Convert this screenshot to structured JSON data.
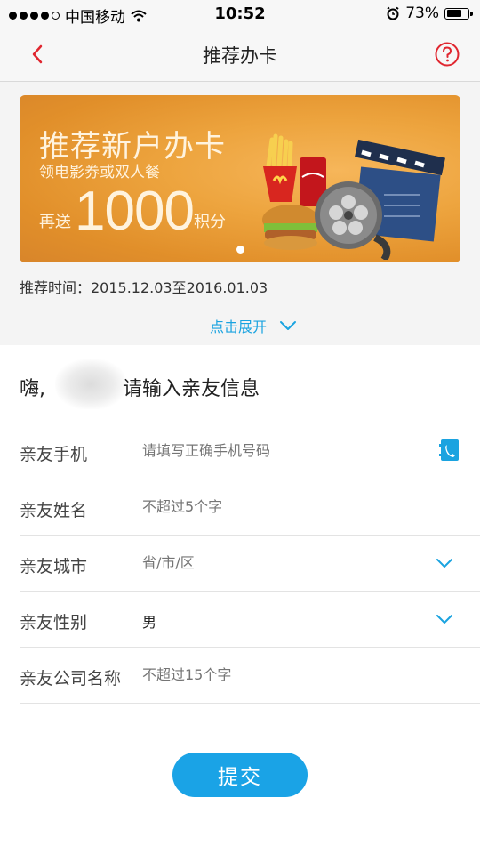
{
  "status_bar": {
    "carrier": "中国移动",
    "time": "10:52",
    "battery_percent": "73%",
    "battery_level": 0.73,
    "icons": [
      "signal-dots-icon",
      "wifi-icon",
      "alarm-icon",
      "battery-icon"
    ]
  },
  "nav": {
    "title": "推荐办卡",
    "back_icon": "chevron-left-icon",
    "help_icon": "question-circle-icon",
    "accent_color": "#e0262f"
  },
  "banner": {
    "title": "推荐新户办卡",
    "subtitle": "领电影券或双人餐",
    "prefix": "再送",
    "points": "1000",
    "suffix": "积分",
    "art": "burger-fries-film-reel-clapperboard-illustration"
  },
  "promo": {
    "time_text": "推荐时间：2015.12.03至2016.01.03",
    "expand_label": "点击展开"
  },
  "greeting": {
    "hi": "嗨,",
    "prompt": "请输入亲友信息"
  },
  "form": {
    "phone": {
      "label": "亲友手机",
      "placeholder": "请填写正确手机号码",
      "icon": "contacts-phone-icon"
    },
    "name": {
      "label": "亲友姓名",
      "placeholder": "不超过5个字"
    },
    "city": {
      "label": "亲友城市",
      "placeholder": "省/市/区",
      "icon": "chevron-down-icon"
    },
    "gender": {
      "label": "亲友性别",
      "value": "男",
      "icon": "chevron-down-icon"
    },
    "company": {
      "label": "亲友公司名称",
      "placeholder": "不超过15个字"
    }
  },
  "submit_label": "提交",
  "colors": {
    "primary": "#1aa3e6",
    "banner": "#eda43e",
    "link": "#1aa3e0"
  }
}
